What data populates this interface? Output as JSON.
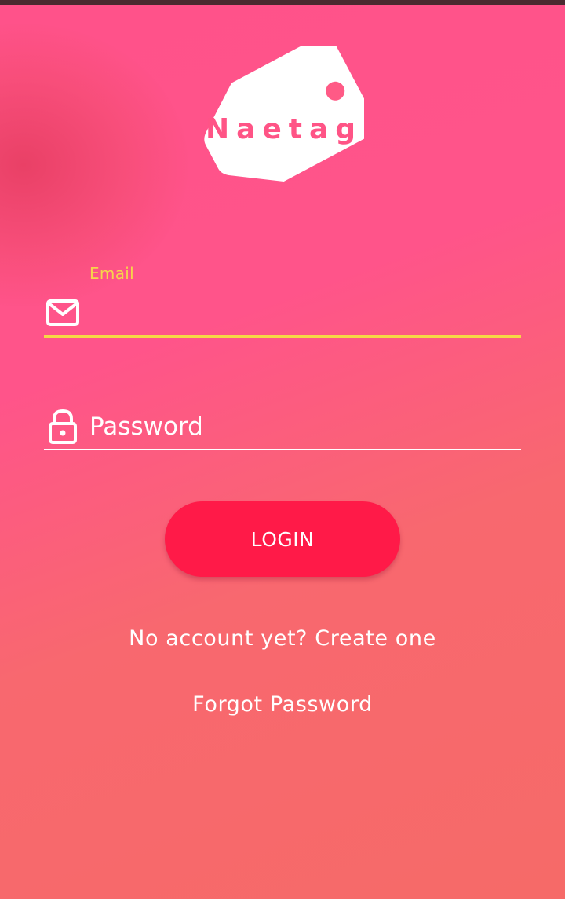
{
  "app": {
    "brand_name": "Naetag"
  },
  "colors": {
    "accent_yellow": "#f6d54a",
    "login_button": "#ff1a48",
    "background_top": "#ff528a",
    "background_bottom": "#f66a68"
  },
  "login_form": {
    "email": {
      "label": "Email",
      "value": "",
      "icon": "mail-icon"
    },
    "password": {
      "placeholder": "Password",
      "value": "",
      "icon": "lock-icon"
    },
    "login_label": "LOGIN",
    "create_account_label": "No account yet? Create one",
    "forgot_password_label": "Forgot Password"
  }
}
